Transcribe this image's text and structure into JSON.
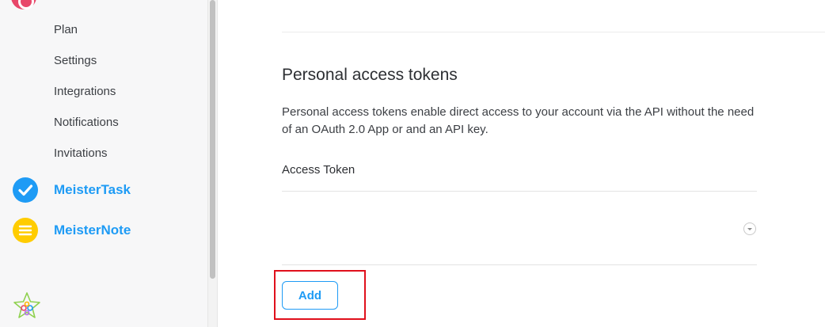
{
  "sidebar": {
    "nav_items": [
      {
        "label": "Plan"
      },
      {
        "label": "Settings"
      },
      {
        "label": "Integrations"
      },
      {
        "label": "Notifications"
      },
      {
        "label": "Invitations"
      }
    ],
    "apps": [
      {
        "label": "MeisterTask",
        "icon": "checkmark-icon",
        "color": "#1e9bf5"
      },
      {
        "label": "MeisterNote",
        "icon": "lines-icon",
        "color": "#ffcc00"
      }
    ]
  },
  "main": {
    "section_title": "Personal access tokens",
    "section_description": "Personal access tokens enable direct access to your account via the API without the need of an OAuth 2.0 App or and an API key.",
    "table": {
      "column_header": "Access Token"
    },
    "add_button_label": "Add"
  },
  "colors": {
    "accent": "#1e9bf5",
    "highlight": "#e0101c",
    "mindmeister": "#e8476a"
  }
}
